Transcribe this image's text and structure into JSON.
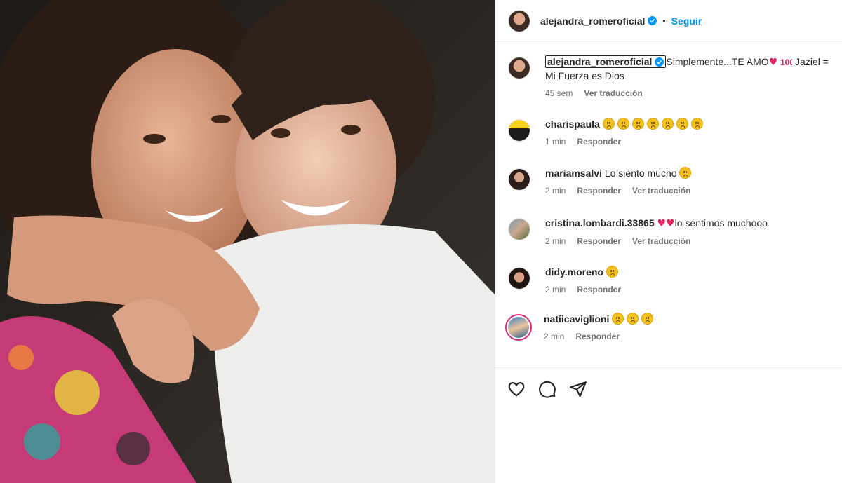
{
  "post": {
    "author": "alejandra_romeroficial",
    "follow_label": "Seguir",
    "separator": "•",
    "caption_text": "Simplemente...TE AMO",
    "caption_after": "Jaziel = Mi Fuerza es Dios",
    "caption_time": "45 sem",
    "caption_translate": "Ver traducción",
    "caption_icons": [
      "heart-icon",
      "hundred-points-icon"
    ]
  },
  "comments": [
    {
      "user": "charispaula",
      "text": "",
      "emoji_count": 7,
      "time": "1 min",
      "reply": "Responder",
      "translate": ""
    },
    {
      "user": "mariamsalvi",
      "text": "Lo siento mucho",
      "emoji_count": 1,
      "time": "2 min",
      "reply": "Responder",
      "translate": "Ver traducción"
    },
    {
      "user": "cristina.lombardi.33865",
      "text": "lo sentimos muchooo",
      "emoji_count": 0,
      "hearts": 2,
      "time": "2 min",
      "reply": "Responder",
      "translate": "Ver traducción"
    },
    {
      "user": "didy.moreno",
      "text": "",
      "emoji_count": 1,
      "time": "2 min",
      "reply": "Responder",
      "translate": ""
    },
    {
      "user": "natiicaviglioni",
      "text": "",
      "emoji_count": 3,
      "time": "2 min",
      "reply": "Responder",
      "translate": ""
    }
  ],
  "actions": [
    "like-icon",
    "comment-icon",
    "share-icon"
  ],
  "colors": {
    "accent": "#0095f6",
    "heart": "#e0245e",
    "muted": "#737373",
    "story_ring": "#d62976"
  }
}
